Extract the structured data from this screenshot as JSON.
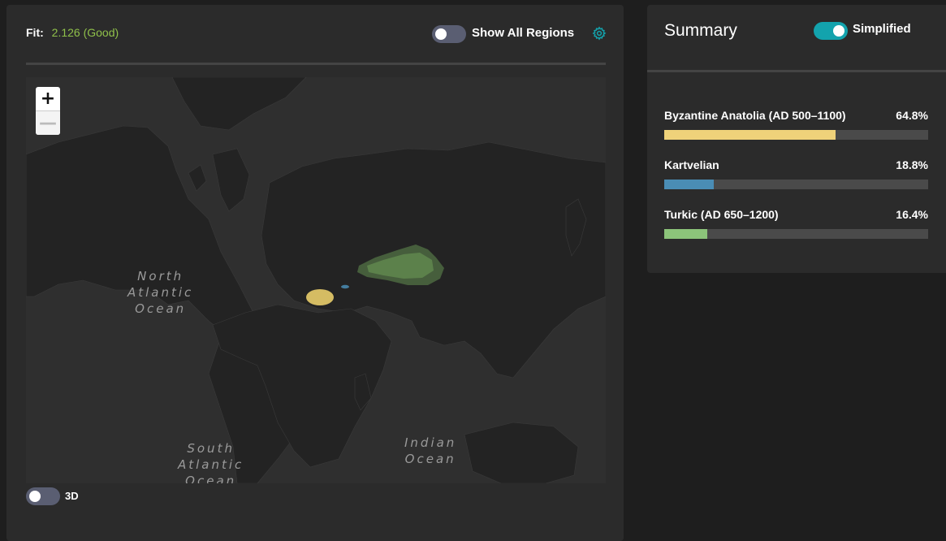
{
  "fit": {
    "label": "Fit:",
    "value": "2.126 (Good)"
  },
  "controls": {
    "show_all_label": "Show All Regions",
    "show_all_on": false,
    "three_d_label": "3D",
    "three_d_on": false,
    "zoom_in": "+",
    "zoom_out": "—"
  },
  "map": {
    "oceans": [
      {
        "lines": [
          "North",
          "Atlantic",
          "Ocean"
        ]
      },
      {
        "lines": [
          "South",
          "Atlantic",
          "Ocean"
        ]
      },
      {
        "lines": [
          "Indian",
          "Ocean"
        ]
      }
    ]
  },
  "summary": {
    "title": "Summary",
    "simplified_label": "Simplified",
    "simplified_on": true,
    "populations": [
      {
        "name": "Byzantine Anatolia (AD 500–1100)",
        "percent": "64.8%",
        "value": 0.648,
        "color": "#efd27a"
      },
      {
        "name": "Kartvelian",
        "percent": "18.8%",
        "value": 0.188,
        "color": "#4a8db5"
      },
      {
        "name": "Turkic (AD 650–1200)",
        "percent": "16.4%",
        "value": 0.164,
        "color": "#8cc47a"
      }
    ]
  },
  "colors": {
    "fit_good": "#8fc04a",
    "toggle_on": "#13a3ad",
    "toggle_off": "#5a5e72",
    "accent_gear": "#13a3ad"
  }
}
